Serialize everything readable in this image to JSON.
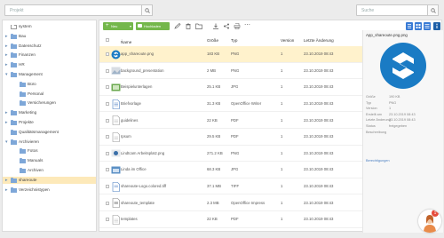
{
  "search_left": {
    "placeholder": "Projekt"
  },
  "search_right": {
    "placeholder": "Suche"
  },
  "tree": [
    {
      "label": "system",
      "indent": 0,
      "arrow": "",
      "selected": false,
      "color": "#ffffff"
    },
    {
      "label": "Bau",
      "indent": 0,
      "arrow": "▸",
      "selected": false,
      "color": "#7ea7d8"
    },
    {
      "label": "Datenschutz",
      "indent": 0,
      "arrow": "▸",
      "selected": false,
      "color": "#7ea7d8"
    },
    {
      "label": "Finanzen",
      "indent": 0,
      "arrow": "▸",
      "selected": false,
      "color": "#7ea7d8"
    },
    {
      "label": "HR",
      "indent": 0,
      "arrow": "▸",
      "selected": false,
      "color": "#7ea7d8"
    },
    {
      "label": "Management",
      "indent": 0,
      "arrow": "▾",
      "selected": false,
      "color": "#7ea7d8"
    },
    {
      "label": "Büro",
      "indent": 1,
      "arrow": "",
      "selected": false,
      "color": "#7ea7d8"
    },
    {
      "label": "Personal",
      "indent": 1,
      "arrow": "",
      "selected": false,
      "color": "#7ea7d8"
    },
    {
      "label": "Versicherungen",
      "indent": 1,
      "arrow": "",
      "selected": false,
      "color": "#7ea7d8"
    },
    {
      "label": "Marketing",
      "indent": 0,
      "arrow": "▸",
      "selected": false,
      "color": "#7ea7d8"
    },
    {
      "label": "Projekte",
      "indent": 0,
      "arrow": "▸",
      "selected": false,
      "color": "#7ea7d8"
    },
    {
      "label": "Qualitätsmanagement",
      "indent": 0,
      "arrow": "",
      "selected": false,
      "color": "#7ea7d8"
    },
    {
      "label": "Archivieren",
      "indent": 0,
      "arrow": "▾",
      "selected": false,
      "color": "#7ea7d8"
    },
    {
      "label": "Fotos",
      "indent": 1,
      "arrow": "",
      "selected": false,
      "color": "#7ea7d8"
    },
    {
      "label": "Manuals",
      "indent": 1,
      "arrow": "",
      "selected": false,
      "color": "#7ea7d8"
    },
    {
      "label": "Archiven",
      "indent": 1,
      "arrow": "",
      "selected": false,
      "color": "#7ea7d8"
    },
    {
      "label": "shareoute",
      "indent": 0,
      "arrow": "▸",
      "selected": true,
      "color": "#7ea7d8"
    },
    {
      "label": "Verzeichnistypen",
      "indent": 0,
      "arrow": "▸",
      "selected": false,
      "color": "#7ea7d8"
    }
  ],
  "toolbar": {
    "new_label": "Neu",
    "upload_label": "Hochladen"
  },
  "columns": {
    "name": "Name",
    "sort": "↑",
    "size": "Größe",
    "type": "Typ",
    "version": "Version",
    "modified": "Letzte Änderung"
  },
  "files": [
    {
      "name": "app_shareoute.png",
      "size": "183 KB",
      "type": "PNG",
      "version": "1",
      "modified": "23.10.2019 08:43",
      "thumb": "logo",
      "selected": true
    },
    {
      "name": "background_presentation",
      "size": "2 MB",
      "type": "PNG",
      "version": "1",
      "modified": "23.10.2019 08:43",
      "thumb": "image",
      "selected": false
    },
    {
      "name": "Beispielunterlagen",
      "size": "25.1 KB",
      "type": "JPG",
      "version": "1",
      "modified": "23.10.2019 08:43",
      "thumb": "image2",
      "selected": false
    },
    {
      "name": "Briefvorlage",
      "size": "31.3 KB",
      "type": "OpenOffice Writer",
      "version": "1",
      "modified": "23.10.2019 08:43",
      "thumb": "doc",
      "selected": false
    },
    {
      "name": "guidelines",
      "size": "22 KB",
      "type": "PDF",
      "version": "1",
      "modified": "23.10.2019 08:43",
      "thumb": "pdf",
      "selected": false
    },
    {
      "name": "Ipsum",
      "size": "29.5 KB",
      "type": "PDF",
      "version": "1",
      "modified": "23.10.2019 08:43",
      "thumb": "pdf",
      "selected": false
    },
    {
      "name": "Lindtcam Arbeitsplatz.png",
      "size": "271.2 KB",
      "type": "PNG",
      "version": "1",
      "modified": "23.10.2019 08:43",
      "thumb": "image3",
      "selected": false
    },
    {
      "name": "Linda im Office",
      "size": "68.3 KB",
      "type": "JPG",
      "version": "1",
      "modified": "23.10.2019 08:43",
      "thumb": "image4",
      "selected": false
    },
    {
      "name": "shareoute-Logo.colored.tiff",
      "size": "37.1 MB",
      "type": "TIFF",
      "version": "1",
      "modified": "23.10.2019 08:43",
      "thumb": "tiff",
      "selected": false
    },
    {
      "name": "shareoute_template",
      "size": "2.3 MB",
      "type": "OpenOffice Impress",
      "version": "1",
      "modified": "23.10.2019 08:43",
      "thumb": "doc2",
      "selected": false
    },
    {
      "name": "templates",
      "size": "22 KB",
      "type": "PDF",
      "version": "1",
      "modified": "23.10.2019 08:43",
      "thumb": "pdf",
      "selected": false
    }
  ],
  "detail": {
    "title": "App_shareoute.png.png",
    "props": [
      {
        "k": "Größe",
        "v": "190 KB"
      },
      {
        "k": "Typ",
        "v": "PNG"
      },
      {
        "k": "Version",
        "v": "1"
      },
      {
        "k": "Erstellt am",
        "v": "23.10.2019 08:43"
      },
      {
        "k": "Letzte Änderung",
        "v": "23.10.2019 08:43"
      },
      {
        "k": "Status",
        "v": "freigegeben"
      },
      {
        "k": "Beschreibung",
        "v": ""
      }
    ],
    "link": "Berechtigungen"
  },
  "fab": {
    "badge": "1"
  },
  "colors": {
    "green": "#74b74b",
    "selected_row": "#fff2cc",
    "selected_tree": "#fde9b9",
    "accent": "#1a7bc4",
    "view_active": "#3a7bd5"
  }
}
